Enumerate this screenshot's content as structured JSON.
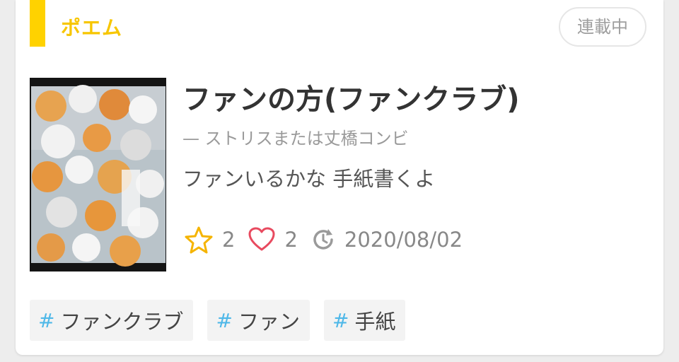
{
  "genre": {
    "label": "ポエム",
    "color": "#ffd200"
  },
  "status_badge": "連載中",
  "story": {
    "title": "ファンの方(ファンクラブ)",
    "author_prefix": "—",
    "author": "ストリスまたは丈橋コンビ",
    "description": "ファンいるかな 手紙書くよ",
    "stars": "2",
    "likes": "2",
    "updated": "2020/08/02"
  },
  "icons": {
    "star": "star-icon",
    "heart": "heart-icon",
    "update": "refresh-clock-icon"
  },
  "colors": {
    "star": "#f5b400",
    "heart": "#e84a5f",
    "update": "#9a9a9a",
    "hash": "#4fb8e8"
  },
  "tags": [
    {
      "hash": "#",
      "label": "ファンクラブ"
    },
    {
      "hash": "#",
      "label": "ファン"
    },
    {
      "hash": "#",
      "label": "手紙"
    }
  ]
}
